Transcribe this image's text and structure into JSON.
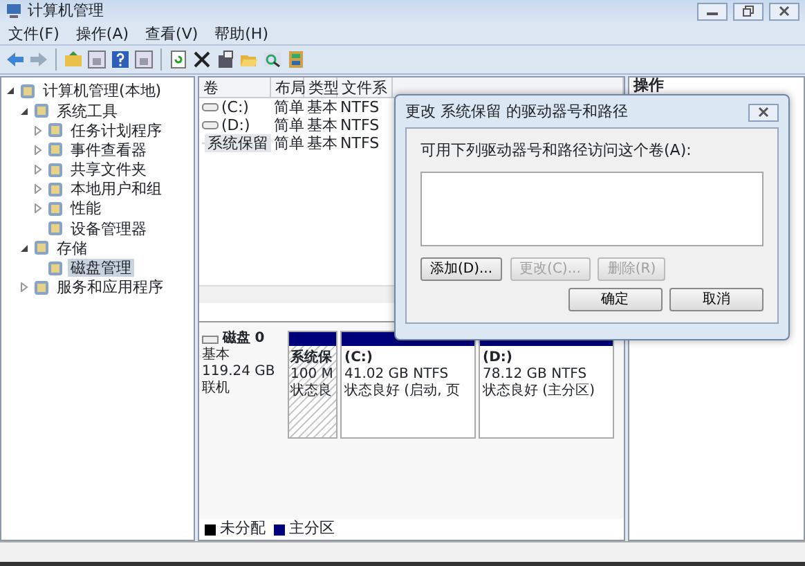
{
  "window": {
    "title": "计算机管理"
  },
  "menu": [
    "文件(F)",
    "操作(A)",
    "查看(V)",
    "帮助(H)"
  ],
  "tree": [
    {
      "label": "计算机管理(本地)",
      "selected": false,
      "expanded": true,
      "children": [
        {
          "label": "系统工具",
          "selected": false,
          "expanded": true,
          "children": [
            {
              "label": "任务计划程序",
              "selected": false,
              "expanded": false
            },
            {
              "label": "事件查看器",
              "selected": false,
              "expanded": false
            },
            {
              "label": "共享文件夹",
              "selected": false,
              "expanded": false
            },
            {
              "label": "本地用户和组",
              "selected": false,
              "expanded": false
            },
            {
              "label": "性能",
              "selected": false,
              "expanded": false
            },
            {
              "label": "设备管理器",
              "selected": false
            }
          ]
        },
        {
          "label": "存储",
          "selected": false,
          "expanded": true,
          "children": [
            {
              "label": "磁盘管理",
              "selected": true
            }
          ]
        },
        {
          "label": "服务和应用程序",
          "selected": false,
          "expanded": false
        }
      ]
    }
  ],
  "volumes": {
    "columns": [
      "卷",
      "布局",
      "类型",
      "文件系"
    ],
    "rows": [
      {
        "cells": [
          "(C:)",
          "简单",
          "基本",
          "NTFS"
        ],
        "selected": false
      },
      {
        "cells": [
          "(D:)",
          "简单",
          "基本",
          "NTFS"
        ],
        "selected": false
      },
      {
        "cells": [
          "系统保留",
          "简单",
          "基本",
          "NTFS"
        ],
        "selected": true
      }
    ]
  },
  "disk": {
    "name": "磁盘 0",
    "type": "基本",
    "size": "119.24 GB",
    "status": "联机",
    "partitions": [
      {
        "lines": [
          "系统保",
          "100 M",
          "状态良"
        ],
        "selected": true,
        "color": "#00007b"
      },
      {
        "lines": [
          "(C:)",
          "41.02 GB NTFS",
          "状态良好 (启动, 页"
        ],
        "selected": false,
        "color": "#00007b"
      },
      {
        "lines": [
          "(D:)",
          "78.12 GB NTFS",
          "状态良好 (主分区)"
        ],
        "selected": false,
        "color": "#00007b"
      }
    ]
  },
  "legend": [
    {
      "label": "未分配",
      "color": "#000000"
    },
    {
      "label": "主分区",
      "color": "#00007b"
    }
  ],
  "actions": {
    "title": "操作"
  },
  "dialog": {
    "title": "更改 系统保留 的驱动器号和路径",
    "label": "可用下列驱动器号和路径访问这个卷(A):",
    "buttons": [
      {
        "label": "添加(D)...",
        "disabled": false
      },
      {
        "label": "更改(C)...",
        "disabled": true
      },
      {
        "label": "删除(R)",
        "disabled": true
      }
    ],
    "footer": [
      {
        "label": "确定",
        "disabled": false
      },
      {
        "label": "取消",
        "disabled": false
      }
    ]
  }
}
